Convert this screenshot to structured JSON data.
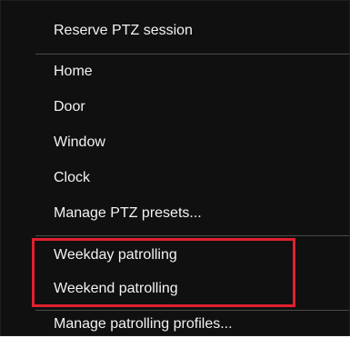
{
  "menu": {
    "items": [
      {
        "label": "Reserve PTZ session"
      },
      {
        "label": "Home"
      },
      {
        "label": "Door"
      },
      {
        "label": "Window"
      },
      {
        "label": "Clock"
      },
      {
        "label": "Manage PTZ presets..."
      },
      {
        "label": "Weekday patrolling"
      },
      {
        "label": "Weekend patrolling"
      },
      {
        "label": "Manage patrolling profiles..."
      }
    ]
  },
  "colors": {
    "menu_background": "#101010",
    "text": "#f2f2f2",
    "separator": "#4a4a4a",
    "highlight_border": "#e0202e"
  }
}
